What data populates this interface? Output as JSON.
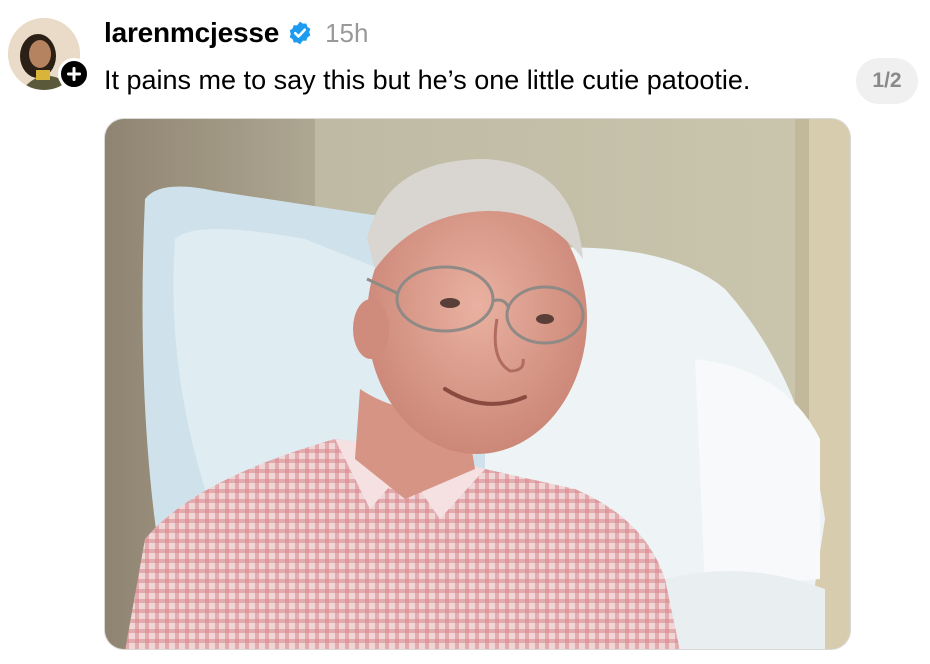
{
  "post": {
    "username": "larenmcjesse",
    "verified_icon": "verified-badge-icon",
    "timestamp": "15h",
    "caption": "It pains me to say this but he’s one little cutie patootie.",
    "media_counter": "1/2",
    "follow_icon": "plus-icon",
    "colors": {
      "verified": "#1d9bf0",
      "timestamp": "#999999",
      "counter_bg": "#f0f0f0",
      "counter_text": "#8a8a8a"
    }
  }
}
